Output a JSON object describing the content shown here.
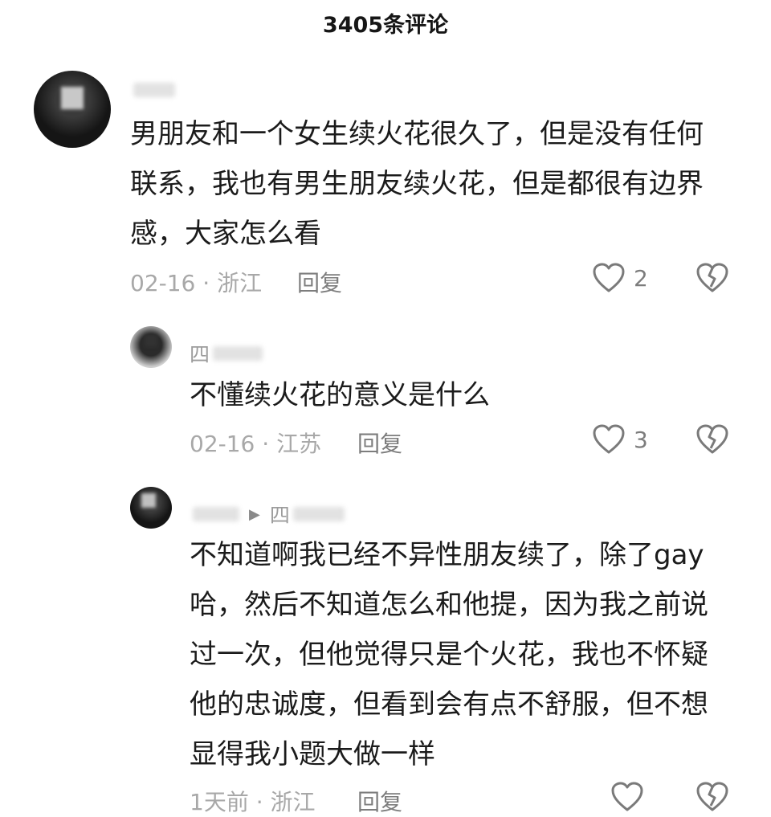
{
  "header": {
    "title": "3405条评论"
  },
  "comments": [
    {
      "username": "",
      "text_lines": [
        "男朋友和一个女生续火花很久了，但是没有任何",
        "联系，我也有男生朋友续火花，但是都很有边界",
        "感，大家怎么看"
      ],
      "date": "02-16",
      "location": "浙江",
      "reply_label": "回复",
      "like_count": "2"
    },
    {
      "username": "四",
      "text_lines": [
        "不懂续火花的意义是什么"
      ],
      "date": "02-16",
      "location": "江苏",
      "reply_label": "回复",
      "like_count": "3"
    },
    {
      "username": "",
      "reply_to": "四",
      "text_lines": [
        "不知道啊我已经不异性朋友续了，除了gay",
        "哈，然后不知道怎么和他提，因为我之前说",
        "过一次，但他觉得只是个火花，我也不怀疑",
        "他的忠诚度，但看到会有点不舒服，但不想",
        "显得我小题大做一样"
      ],
      "date": "1天前",
      "location": "浙江",
      "reply_label": "回复",
      "like_count": ""
    }
  ],
  "separator": " · ",
  "icons": {
    "like": "heart-outline-icon",
    "dislike": "broken-heart-icon"
  }
}
